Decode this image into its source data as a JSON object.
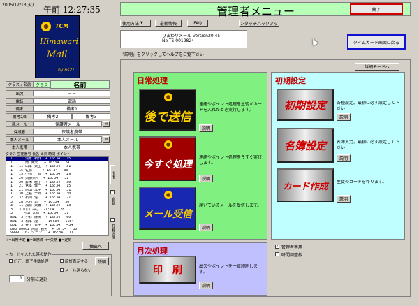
{
  "left": {
    "datetime_small": "2005/12/13(火)",
    "clock": "午前 12:27:35",
    "logo": {
      "tcm": "TCM",
      "line1": "Himawari",
      "line2": "Mail",
      "by": "by ns21"
    },
    "class_label": "クラス / 名前",
    "class_value": "クラス",
    "name_value": "名前",
    "info_rows": [
      {
        "label": "出欠",
        "value": "－－"
      },
      {
        "label": "電話",
        "value": "電話"
      },
      {
        "label": "備考",
        "value": "備考1"
      },
      {
        "label": "備考2/3",
        "value": "備考2",
        "value2": "備考3"
      },
      {
        "label": "親メール",
        "value": "保護者メール"
      },
      {
        "label": "保護者",
        "value": "保護者携帯"
      },
      {
        "label": "本人メール",
        "value": "本人メール"
      },
      {
        "label": "本人携帯",
        "value": "本人携帯"
      }
    ],
    "list_header": "クラス 生徒番号 氏名   出欠  時間   ポイント",
    "list_rows": [
      "  1   11 清水 新作  + 16:34   15",
      "  1   11 南 颯太   + 16:34   24",
      "  1   11 山本 大生  + 16:34   31",
      "  1   15 佐藤     + 16:34   30",
      "  1   15 小川 一郎  + 16:34   29",
      "  1   20 須藤奈々  + 16:34   31",
      "  1   20 鈴木 雅子  + 16:34   30",
      "  1   21 宮本 健一  + 16:34   15",
      "  1   21 前田 洋子  + 16:34   31",
      "  1   30 上島 一郎  + 16:34   30",
      "  2   32 石川 信二  + 16:34   21",
      "  3   28 木村 恵   + 16:34   30",
      "  3   11 加藤 大輔  + 16:34   13",
      "  3   3 山口 みさ  21:14   28",
      "  3   7 吉田 太郎  + 16:34   31",
      "  801  3 小林 麻美  + 16:34   69",
      "  801  3 松本 茂   + 16:34   1184",
      "  801  3 井上 智子  + 16:34   434",
      "  898 80002 阿部 義男  + 16:34   30",
      "  9999 1102 ケーン   + 16:34   11"
    ],
    "side_labels": {
      "switch": "切替",
      "auto": "自動",
      "check": "在籍時間"
    },
    "legend": "+=出席予定 ■=出席済 ×=欠席  ■=遅刻",
    "export_button": "抽出へ",
    "card_group_title": "カードを入れた時の動作",
    "card_options": {
      "opt1": "訂正、終了手動処理",
      "opt2": "暗証表示する",
      "opt3": "メール送らない"
    },
    "stepper_value": "1",
    "stepper_label": "分前に遅刻",
    "help_button": "説明"
  },
  "main": {
    "top_buttons": [
      {
        "label": "使用方法",
        "dropdown": true
      },
      {
        "label": "最新情報"
      },
      {
        "label": "FAQ"
      },
      {
        "label": "ワンタッチバックアップ"
      }
    ],
    "title": "管理者メニュー",
    "exit_button": "終了",
    "version_line1": "ひまわりメール  Version20.45",
    "version_line2": "No-TS 0019824",
    "help_hint": "「説明」をクリックしてヘルプをご覧下さい",
    "timecard_button": "タイムカード画面に戻る",
    "detail_mode_button": "詳細モードへ",
    "sections": {
      "daily": {
        "title": "日常処理",
        "items": [
          {
            "label": "後で送信",
            "desc": "連絡やポイント処理を生徒がカードを入れたとき実行します。",
            "help": "説明"
          },
          {
            "label": "今すぐ処理",
            "desc": "連絡やポイント処理を今すぐ実行します。",
            "help": "説明"
          },
          {
            "label": "メール受信",
            "desc": "届いているメールを受信します。",
            "help": "説明"
          }
        ]
      },
      "monthly": {
        "title": "月次処理",
        "items": [
          {
            "label": "印　刷",
            "desc": "出欠やポイントを一覧印刷します。",
            "help": "説明"
          }
        ]
      },
      "initial": {
        "title": "初期設定",
        "items": [
          {
            "label": "初期設定",
            "desc": "各種設定。最初に必ず設定して下さい",
            "help": "説明"
          },
          {
            "label": "名簿設定",
            "desc": "名簿入力。最初に必ず設定して下さい",
            "help": "説明"
          },
          {
            "label": "カード作成",
            "desc": "生徒のカードを作ります。",
            "help": "説明"
          }
        ]
      }
    },
    "bottom_checks": [
      {
        "label": "管理者専用",
        "checked": true
      },
      {
        "label": "時間調整板",
        "checked": false
      }
    ]
  }
}
